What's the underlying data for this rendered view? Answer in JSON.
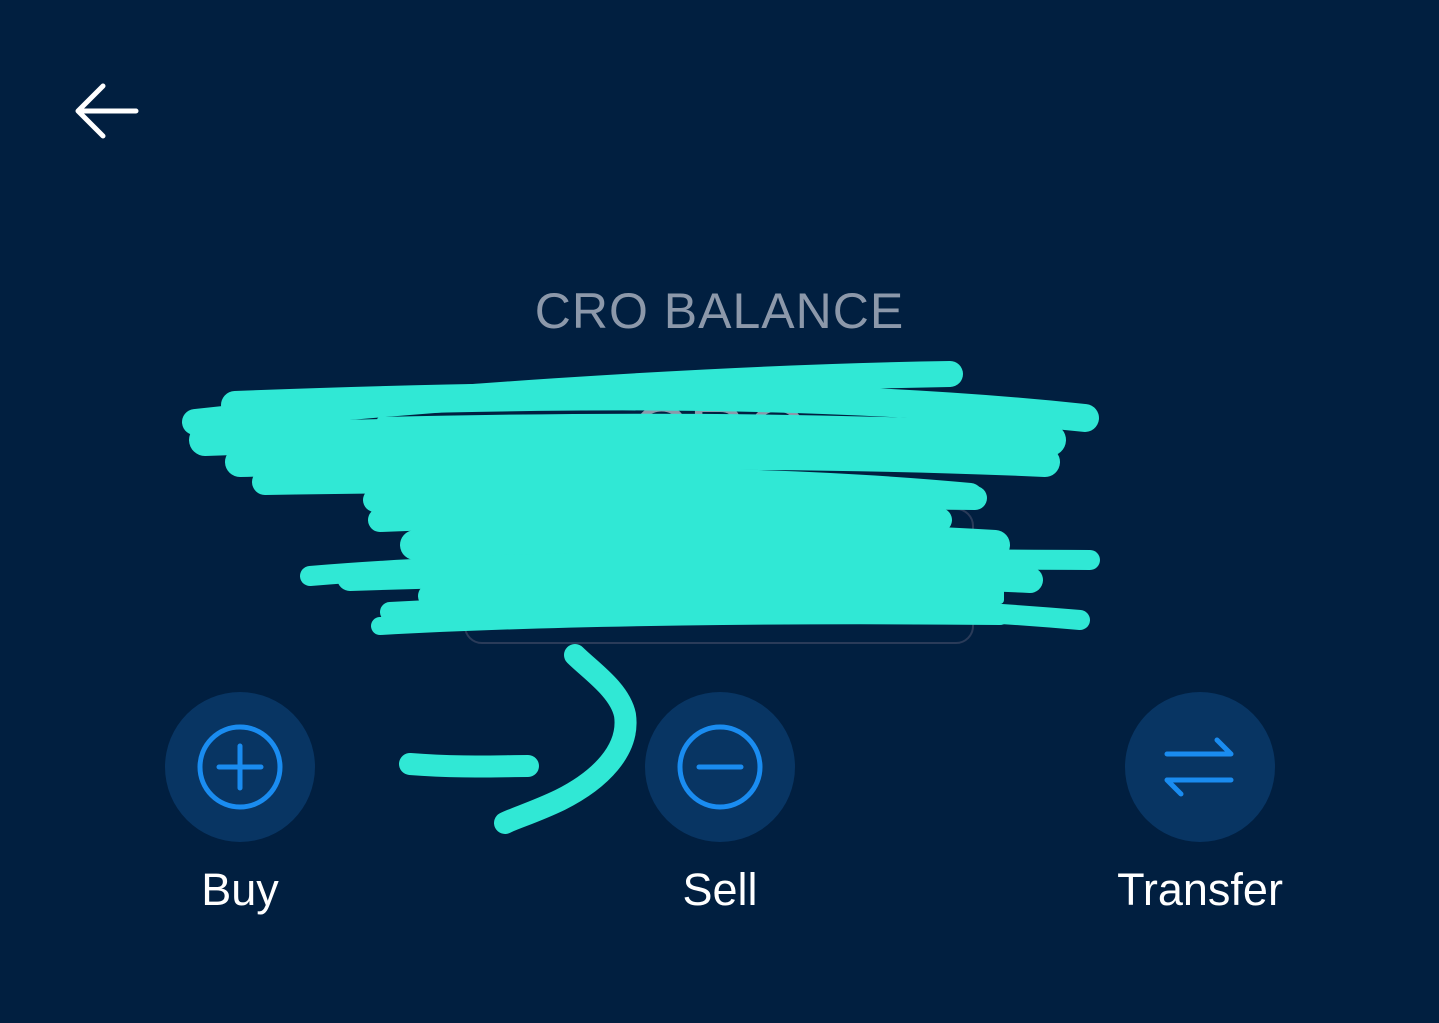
{
  "header": {
    "back_icon": "arrow-left-icon"
  },
  "balance": {
    "label": "CRO BALANCE",
    "amount": "",
    "unit": "CRO",
    "fiat_value": ""
  },
  "actions": [
    {
      "label": "Buy",
      "icon": "plus-circle-icon"
    },
    {
      "label": "Sell",
      "icon": "minus-circle-icon"
    },
    {
      "label": "Transfer",
      "icon": "swap-arrows-icon"
    }
  ],
  "colors": {
    "background": "#011f40",
    "button_bg": "#083563",
    "icon_blue": "#1a8cf0",
    "muted_text": "#8c98aa",
    "annotation": "#30e8d5"
  }
}
